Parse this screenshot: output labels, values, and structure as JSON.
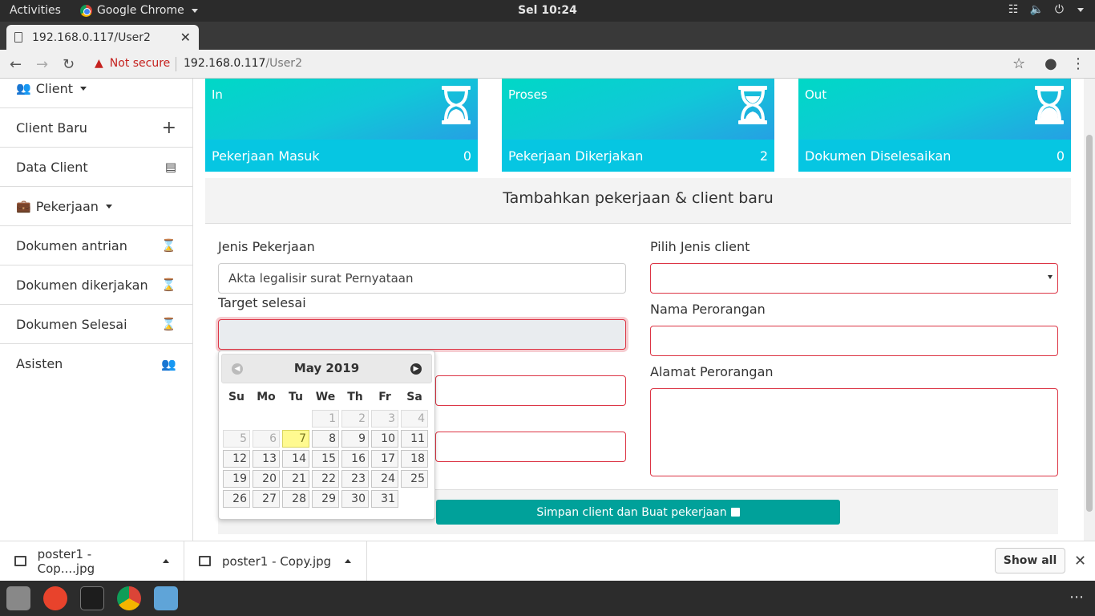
{
  "os": {
    "activities": "Activities",
    "app_name": "Google Chrome",
    "clock": "Sel 10:24"
  },
  "browser": {
    "tab_title": "192.168.0.117/User2",
    "security": "Not secure",
    "url_host": "192.168.0.117",
    "url_path": "/User2"
  },
  "sidebar": {
    "items": [
      {
        "label": "Client",
        "icon": "users-icon",
        "dropdown": true
      },
      {
        "label": "Client Baru",
        "icon": "plus-icon"
      },
      {
        "label": "Data Client",
        "icon": "list-icon"
      },
      {
        "label": "Pekerjaan",
        "icon": "briefcase-icon",
        "dropdown": true
      },
      {
        "label": "Dokumen antrian",
        "icon": "hourglass-icon"
      },
      {
        "label": "Dokumen dikerjakan",
        "icon": "hourglass-icon"
      },
      {
        "label": "Dokumen Selesai",
        "icon": "hourglass-icon"
      },
      {
        "label": "Asisten",
        "icon": "users-icon"
      }
    ]
  },
  "cards": [
    {
      "title": "In",
      "label": "Pekerjaan Masuk",
      "count": "0",
      "icon": "hourglass-start-icon"
    },
    {
      "title": "Proses",
      "label": "Pekerjaan Dikerjakan",
      "count": "2",
      "icon": "hourglass-half-icon"
    },
    {
      "title": "Out",
      "label": "Dokumen Diselesaikan",
      "count": "0",
      "icon": "hourglass-end-icon"
    }
  ],
  "form": {
    "heading": "Tambahkan pekerjaan & client baru",
    "jenis_label": "Jenis Pekerjaan",
    "jenis_value": "Akta legalisir surat Pernyataan",
    "target_label": "Target selesai",
    "target_value": "",
    "pilih_label": "Pilih Jenis client",
    "pilih_value": "",
    "nama_label": "Nama Perorangan",
    "nama_value": "",
    "alamat_label": "Alamat Perorangan",
    "alamat_value": "",
    "save_label": "Simpan client dan Buat pekerjaan",
    "save_icon": "save-icon"
  },
  "datepicker": {
    "month_year": "May 2019",
    "weekdays": [
      "Su",
      "Mo",
      "Tu",
      "We",
      "Th",
      "Fr",
      "Sa"
    ],
    "weeks": [
      [
        "",
        "",
        "",
        "1",
        "2",
        "3",
        "4"
      ],
      [
        "5",
        "6",
        "7",
        "8",
        "9",
        "10",
        "11"
      ],
      [
        "12",
        "13",
        "14",
        "15",
        "16",
        "17",
        "18"
      ],
      [
        "19",
        "20",
        "21",
        "22",
        "23",
        "24",
        "25"
      ],
      [
        "26",
        "27",
        "28",
        "29",
        "30",
        "31",
        ""
      ]
    ],
    "today": "7",
    "disabled_days": [
      "1",
      "2",
      "3",
      "4",
      "5",
      "6"
    ]
  },
  "downloads": {
    "items": [
      {
        "name": "poster1 - Cop....jpg"
      },
      {
        "name": "poster1 - Copy.jpg"
      }
    ],
    "show_all": "Show all"
  },
  "colors": {
    "accent": "#00a19a",
    "card_bottom": "#06c6e2",
    "invalid": "#dc3545"
  }
}
